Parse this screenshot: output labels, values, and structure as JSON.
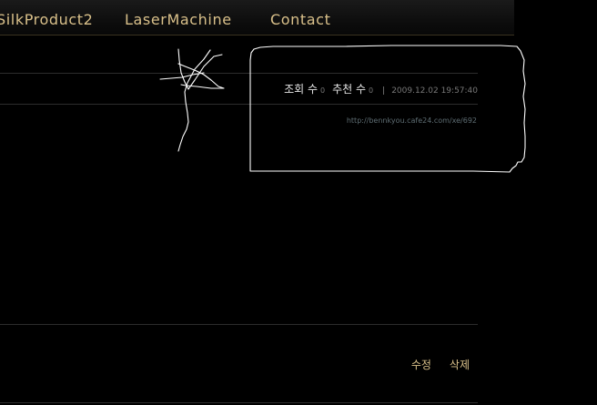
{
  "nav": {
    "items": [
      "SilkProduct2",
      "LaserMachine",
      "Contact"
    ]
  },
  "post": {
    "views_label": "조회 수",
    "views_count": "0",
    "recommend_label": "추천 수",
    "recommend_count": "0",
    "separator": "|",
    "datetime": "2009.12.02 19:57:40",
    "permalink": "http://bennkyou.cafe24.com/xe/692"
  },
  "actions": {
    "edit_label": "수정",
    "delete_label": "삭제"
  },
  "colors": {
    "background": "#000000",
    "nav_text": "#d9c08a",
    "action_text": "#d9c08a",
    "permalink": "#5e6d73",
    "annotation_stroke": "#ffffff"
  }
}
